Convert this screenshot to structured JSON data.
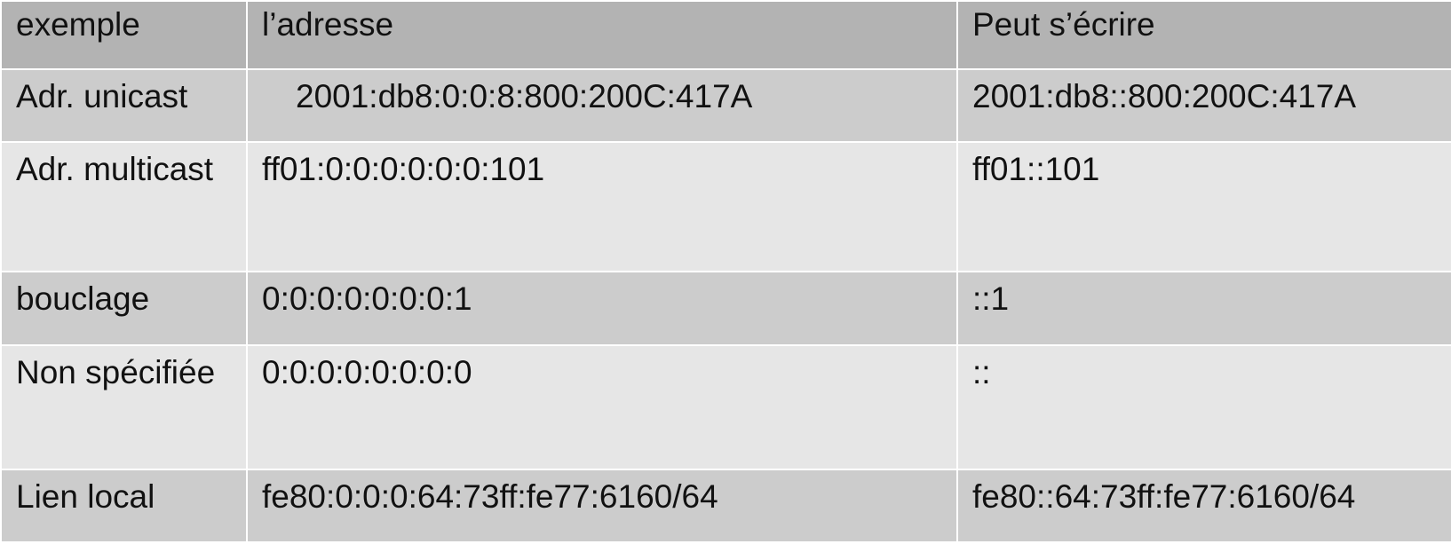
{
  "table": {
    "headers": [
      "exemple",
      "l’adresse",
      "Peut s’écrire"
    ],
    "rows": [
      [
        "Adr. unicast",
        "2001:db8:0:0:8:800:200C:417A",
        "2001:db8::800:200C:417A"
      ],
      [
        "Adr. multicast",
        "ff01:0:0:0:0:0:0:101",
        "ff01::101"
      ],
      [
        "bouclage",
        "0:0:0:0:0:0:0:1",
        "::1"
      ],
      [
        "Non spécifiée",
        "0:0:0:0:0:0:0:0",
        "::"
      ],
      [
        "Lien local",
        "fe80:0:0:0:64:73ff:fe77:6160/64",
        "fe80::64:73ff:fe77:6160/64"
      ]
    ]
  },
  "colors": {
    "header_bg": "#b3b3b3",
    "row_dark_bg": "#cccccc",
    "row_light_bg": "#e6e6e6"
  }
}
